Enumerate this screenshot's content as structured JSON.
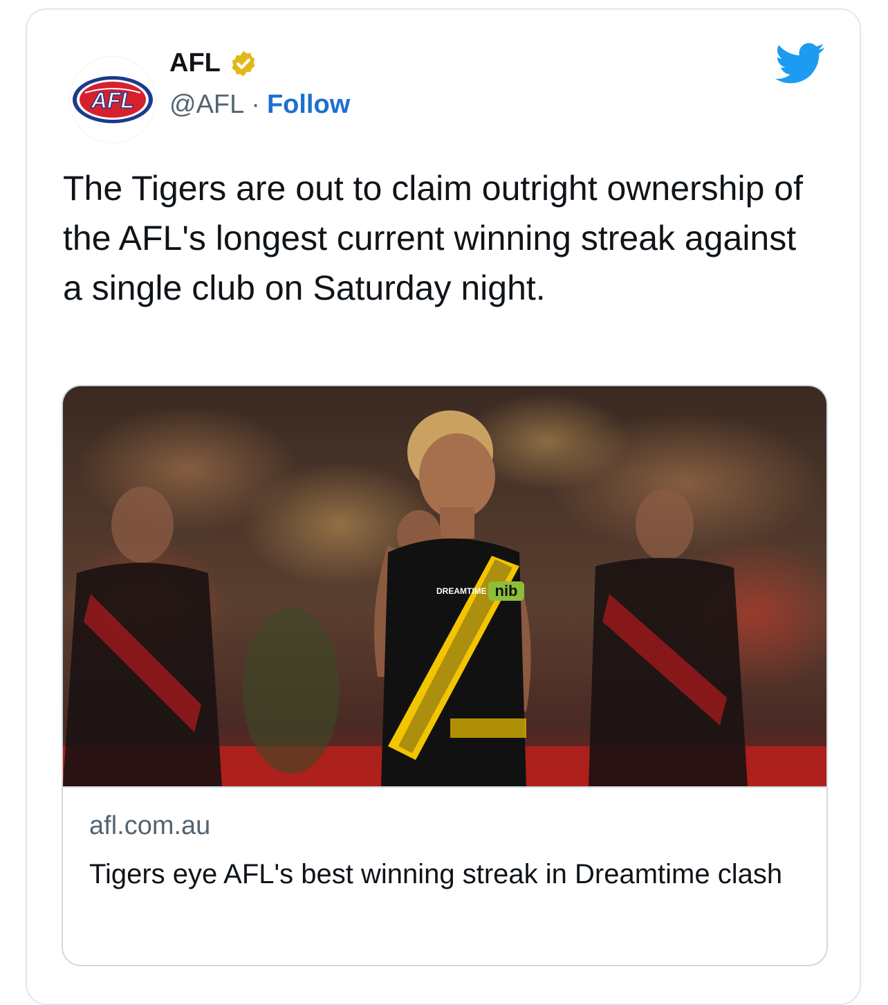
{
  "tweet": {
    "author_name": "AFL",
    "verified": true,
    "avatar_logo_text": "AFL",
    "handle": "@AFL",
    "separator": "·",
    "follow_label": "Follow",
    "text": "The Tigers are out to claim outright ownership of the AFL's longest current winning streak against a single club on Saturday night.",
    "link_card": {
      "image_jersey_text": "DREAMTIME",
      "image_sponsor_text": "nib",
      "domain": "afl.com.au",
      "title": "Tigers eye AFL's best winning streak in Dreamtime clash"
    }
  },
  "colors": {
    "follow_blue": "#1d6fd0",
    "twitter_blue": "#1d9bf0",
    "verified_gold": "#e2b719",
    "secondary_text": "#536471",
    "afl_red": "#d7202e",
    "afl_blue": "#1b3a8c"
  },
  "icons": [
    "afl-logo",
    "verified-badge-icon",
    "twitter-bird-icon"
  ]
}
